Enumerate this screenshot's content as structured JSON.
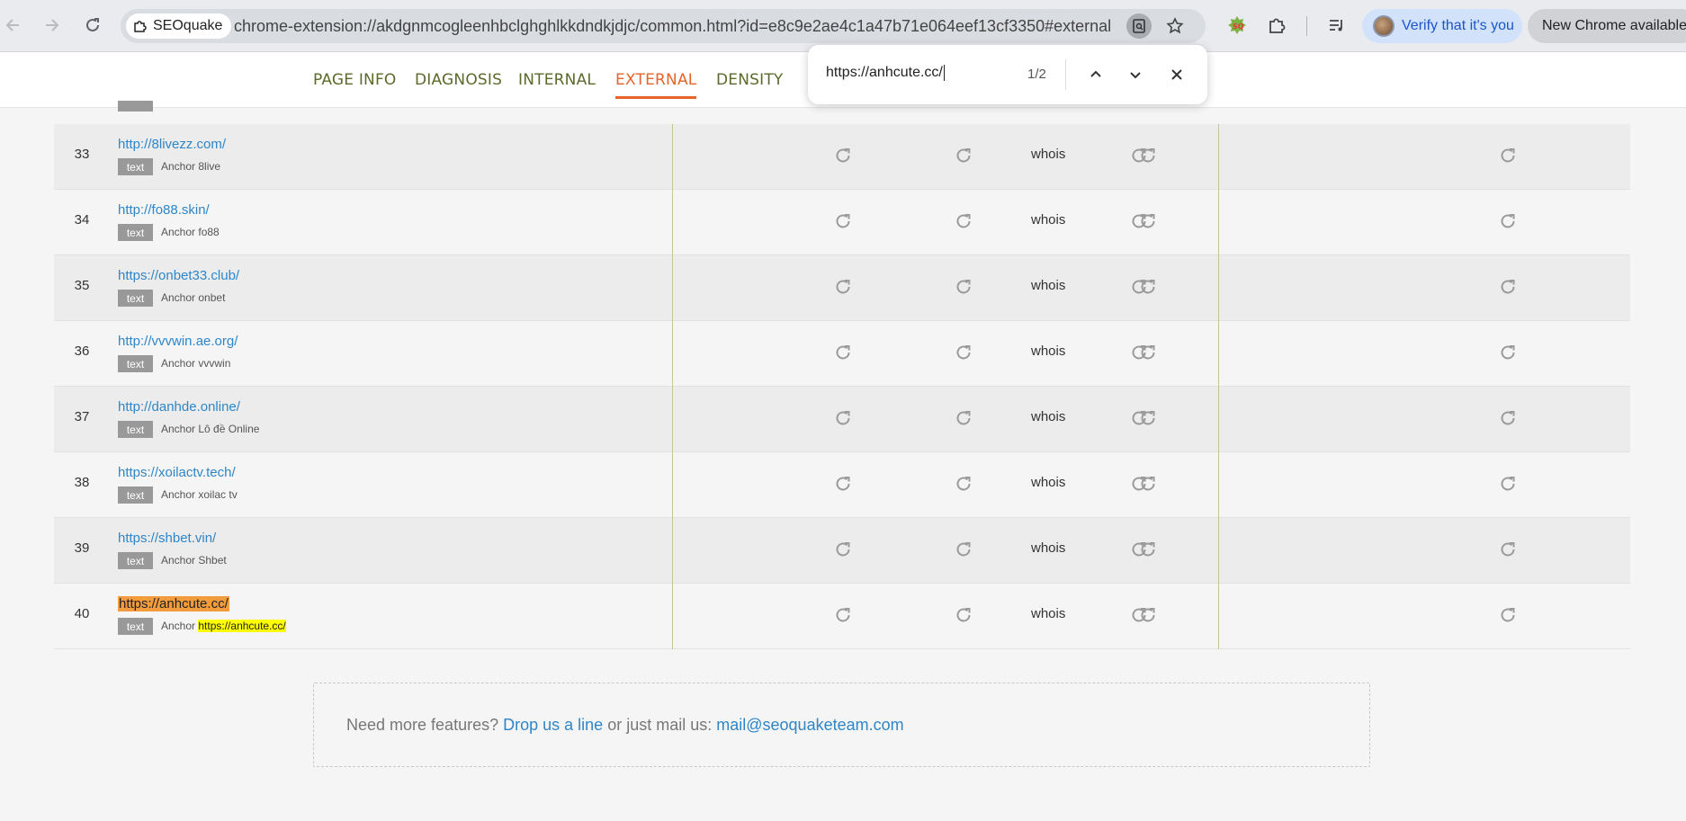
{
  "browser": {
    "site_chip_label": "SEOquake",
    "url": "chrome-extension://akdgnmcogleenhbclghghlkkdndkjdjc/common.html?id=e8c9e2ae4c1a47b71e064eef13cf3350#external",
    "verify_label": "Verify that it's you",
    "new_chrome_label": "New Chrome available"
  },
  "tabs": [
    {
      "label": "PAGE INFO",
      "active": false
    },
    {
      "label": "DIAGNOSIS",
      "active": false
    },
    {
      "label": "INTERNAL",
      "active": false
    },
    {
      "label": "EXTERNAL",
      "active": true
    },
    {
      "label": "DENSITY",
      "active": false
    }
  ],
  "find_bar": {
    "query": "https://anhcute.cc/",
    "count": "1/2"
  },
  "rows": [
    {
      "num": "33",
      "url": "http://8livezz.com/",
      "tag": "text",
      "anchor_prefix": "Anchor",
      "anchor_text": "8live",
      "whois": "whois",
      "highlight": false
    },
    {
      "num": "34",
      "url": "http://fo88.skin/",
      "tag": "text",
      "anchor_prefix": "Anchor",
      "anchor_text": "fo88",
      "whois": "whois",
      "highlight": false
    },
    {
      "num": "35",
      "url": "https://onbet33.club/",
      "tag": "text",
      "anchor_prefix": "Anchor",
      "anchor_text": "onbet",
      "whois": "whois",
      "highlight": false
    },
    {
      "num": "36",
      "url": "http://vvvwin.ae.org/",
      "tag": "text",
      "anchor_prefix": "Anchor",
      "anchor_text": "vvvwin",
      "whois": "whois",
      "highlight": false
    },
    {
      "num": "37",
      "url": "http://danhde.online/",
      "tag": "text",
      "anchor_prefix": "Anchor",
      "anchor_text": "Lô đề Online",
      "whois": "whois",
      "highlight": false
    },
    {
      "num": "38",
      "url": "https://xoilactv.tech/",
      "tag": "text",
      "anchor_prefix": "Anchor",
      "anchor_text": "xoilac tv",
      "whois": "whois",
      "highlight": false
    },
    {
      "num": "39",
      "url": "https://shbet.vin/",
      "tag": "text",
      "anchor_prefix": "Anchor",
      "anchor_text": "Shbet",
      "whois": "whois",
      "highlight": false
    },
    {
      "num": "40",
      "url": "https://anhcute.cc/",
      "tag": "text",
      "anchor_prefix": "Anchor",
      "anchor_text": "https://anhcute.cc/",
      "whois": "whois",
      "highlight": true
    }
  ],
  "footer": {
    "prefix": "Need more features?",
    "link1": "Drop us a line",
    "middle": "or just mail us:",
    "email": "mail@seoquaketeam.com"
  },
  "colors": {
    "accent": "#e5642a",
    "link": "#2e86c9",
    "tab_text": "#5b6a2b",
    "find_current_highlight": "#f39c3d",
    "find_other_highlight": "#ffff00"
  }
}
